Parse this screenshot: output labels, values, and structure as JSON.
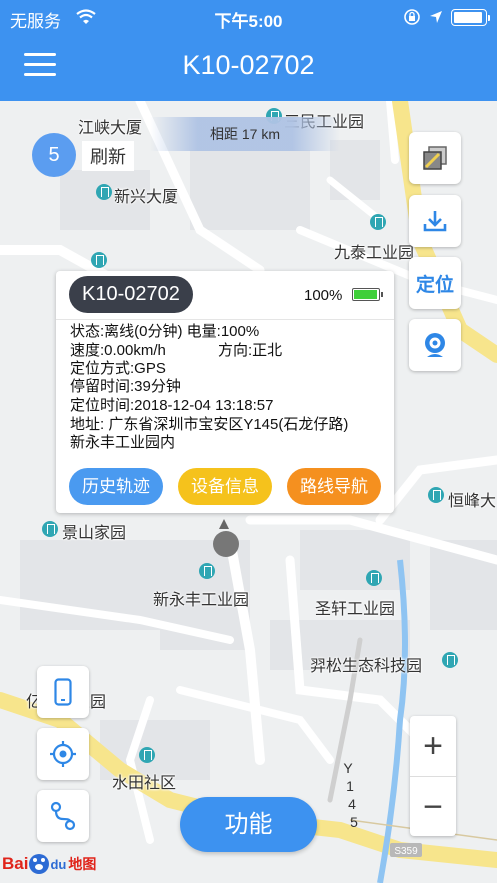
{
  "status_bar": {
    "carrier": "无服务",
    "time": "下午5:00"
  },
  "nav": {
    "title": "K10-02702",
    "menu_icon": "hamburger-menu-icon"
  },
  "map": {
    "distance_label": "相距 17 km",
    "countdown": "5",
    "refresh_label": "刷新",
    "locate_label": "定位",
    "zoom_in": "+",
    "zoom_out": "−",
    "road_label_y145": "Y145",
    "road_label_s359": "S359",
    "pois": [
      {
        "name": "江峡大厦"
      },
      {
        "name": "三民工业园"
      },
      {
        "name": "新兴大厦"
      },
      {
        "name": "九泰工业园"
      },
      {
        "name": "恒峰大"
      },
      {
        "name": "景山家园"
      },
      {
        "name": "新永丰工业园"
      },
      {
        "name": "圣轩工业园"
      },
      {
        "name": "羿松生态科技园"
      },
      {
        "name": "亿丰工业园"
      },
      {
        "name": "水田社区"
      }
    ],
    "logo": {
      "text_a": "Bai",
      "text_b": "du",
      "text_c": "地图"
    }
  },
  "popup": {
    "plate": "K10-02702",
    "battery_percent": "100%",
    "battery_level": 1.0,
    "lines": [
      "状态:离线(0分钟) 电量:100%",
      "速度:0.00km/h",
      "定位方式:GPS",
      "停留时间:39分钟",
      "定位时间:2018-12-04 13:18:57",
      "地址: 广东省深圳市宝安区Y145(石龙仔路)",
      "新永丰工业园内"
    ],
    "direction": "方向:正北",
    "buttons": {
      "history": "历史轨迹",
      "device": "设备信息",
      "navigate": "路线导航"
    }
  },
  "function_button": "功能",
  "colors": {
    "primary_blue": "#3d92f0",
    "history_btn": "#4a9af0",
    "device_btn": "#f5c21c",
    "navigate_btn": "#f5901f",
    "battery_green": "#3fcf3a",
    "road_yellow": "#f7e58c"
  }
}
